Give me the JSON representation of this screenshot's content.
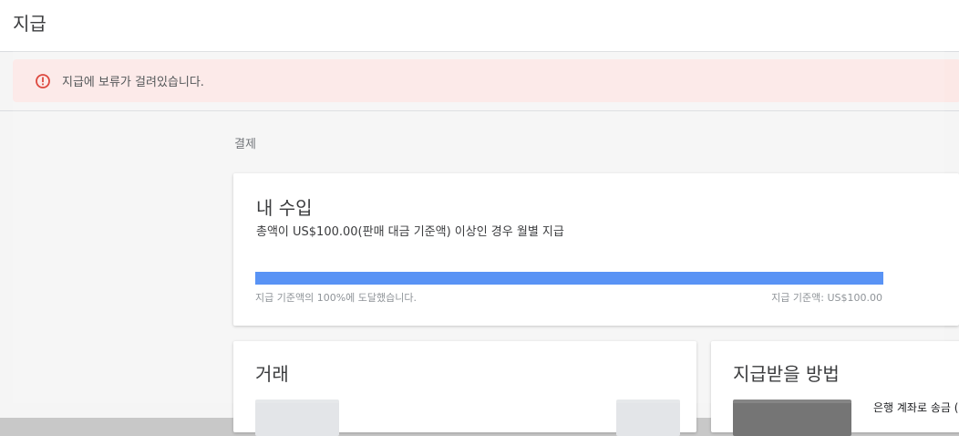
{
  "header": {
    "title": "지급"
  },
  "alert": {
    "icon": "error-icon",
    "message": "지급에 보류가 걸려있습니다."
  },
  "section": {
    "label": "결제"
  },
  "earnings": {
    "title": "내 수입",
    "subtitle": "총액이 US$100.00(판매 대금 기준액) 이상인 경우 월별 지급",
    "progress_percent": 100,
    "progress_text": "지급 기준액의 100%에 도달했습니다.",
    "threshold_text": "지급 기준액: US$100.00",
    "progress_color": "#4285f4"
  },
  "transactions": {
    "title": "거래"
  },
  "payment_method": {
    "title": "지급받을 방법",
    "bank_text": "은행 계좌로 송금 ("
  },
  "colors": {
    "alert_bg": "#fce8e6",
    "alert_icon": "#d93025"
  }
}
